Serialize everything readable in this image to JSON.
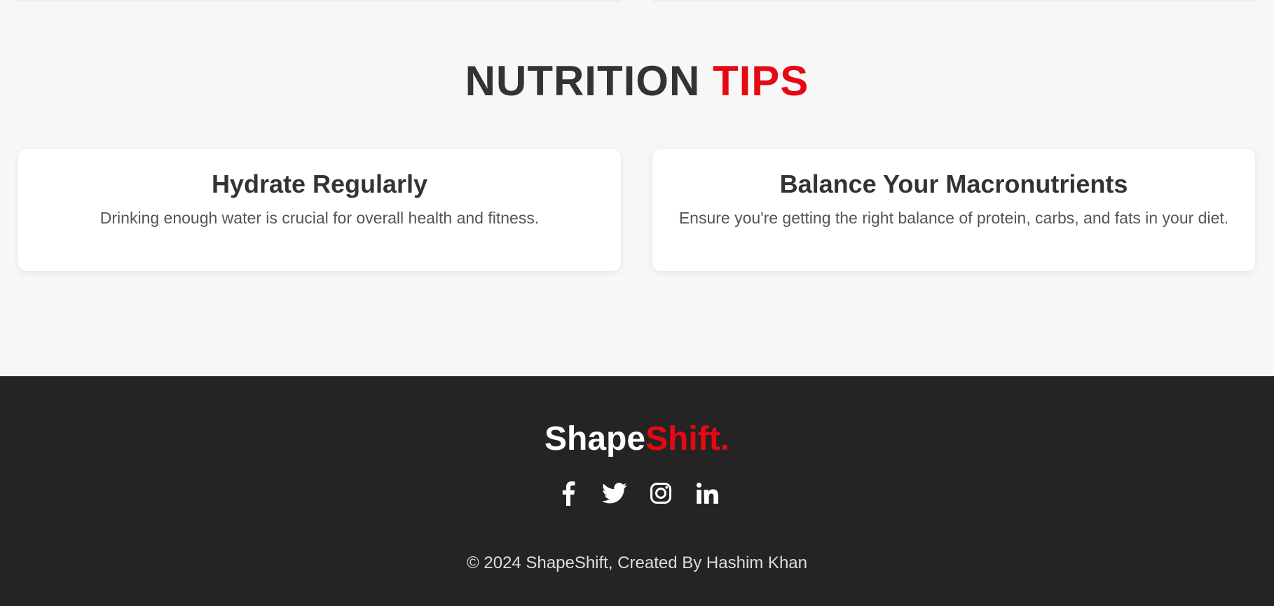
{
  "section": {
    "title_main": "NUTRITION ",
    "title_accent": "TIPS",
    "accent_color": "#e50914"
  },
  "cards": [
    {
      "title": "Hydrate Regularly",
      "text": "Drinking enough water is crucial for overall health and fitness."
    },
    {
      "title": "Balance Your Macronutrients",
      "text": "Ensure you're getting the right balance of protein, carbs, and fats in your diet."
    }
  ],
  "footer": {
    "brand_main": "Shape",
    "brand_accent": "Shift.",
    "background_color": "#242424",
    "social_icons": [
      "facebook-icon",
      "twitter-icon",
      "instagram-icon",
      "linkedin-icon"
    ],
    "copyright": "© 2024 ShapeShift, Created By Hashim Khan"
  }
}
